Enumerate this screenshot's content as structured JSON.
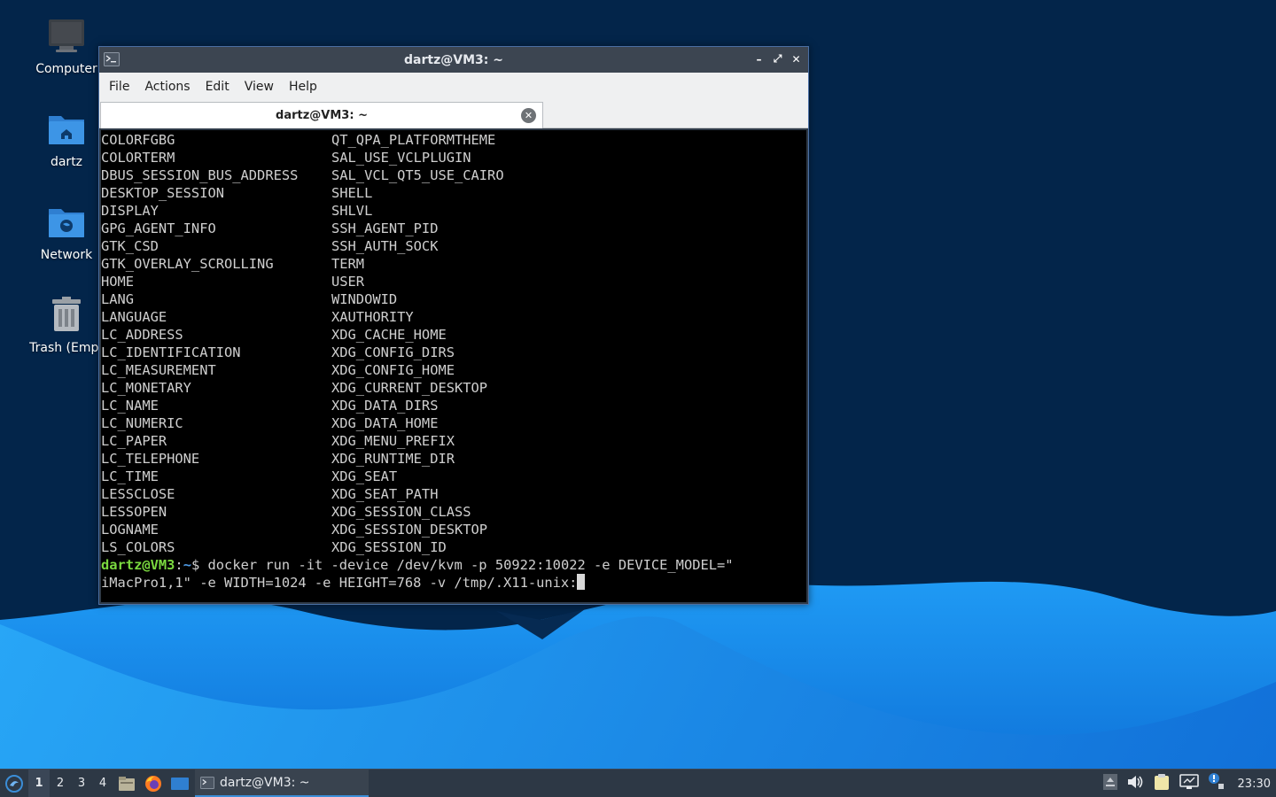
{
  "desktop": {
    "icons": [
      {
        "label": "Computer",
        "icon": "computer-icon"
      },
      {
        "label": "dartz",
        "icon": "home-folder-icon"
      },
      {
        "label": "Network",
        "icon": "network-folder-icon"
      },
      {
        "label": "Trash (Empt",
        "icon": "trash-icon"
      }
    ]
  },
  "window": {
    "title": "dartz@VM3: ~",
    "menu": [
      "File",
      "Actions",
      "Edit",
      "View",
      "Help"
    ],
    "tab_label": "dartz@VM3: ~",
    "tab_close_glyph": "✕",
    "controls": {
      "minimize": "–",
      "maximize": "⤢",
      "close": "✕"
    }
  },
  "terminal": {
    "env_rows": [
      [
        "COLORFGBG",
        "QT_QPA_PLATFORMTHEME"
      ],
      [
        "COLORTERM",
        "SAL_USE_VCLPLUGIN"
      ],
      [
        "DBUS_SESSION_BUS_ADDRESS",
        "SAL_VCL_QT5_USE_CAIRO"
      ],
      [
        "DESKTOP_SESSION",
        "SHELL"
      ],
      [
        "DISPLAY",
        "SHLVL"
      ],
      [
        "GPG_AGENT_INFO",
        "SSH_AGENT_PID"
      ],
      [
        "GTK_CSD",
        "SSH_AUTH_SOCK"
      ],
      [
        "GTK_OVERLAY_SCROLLING",
        "TERM"
      ],
      [
        "HOME",
        "USER"
      ],
      [
        "LANG",
        "WINDOWID"
      ],
      [
        "LANGUAGE",
        "XAUTHORITY"
      ],
      [
        "LC_ADDRESS",
        "XDG_CACHE_HOME"
      ],
      [
        "LC_IDENTIFICATION",
        "XDG_CONFIG_DIRS"
      ],
      [
        "LC_MEASUREMENT",
        "XDG_CONFIG_HOME"
      ],
      [
        "LC_MONETARY",
        "XDG_CURRENT_DESKTOP"
      ],
      [
        "LC_NAME",
        "XDG_DATA_DIRS"
      ],
      [
        "LC_NUMERIC",
        "XDG_DATA_HOME"
      ],
      [
        "LC_PAPER",
        "XDG_MENU_PREFIX"
      ],
      [
        "LC_TELEPHONE",
        "XDG_RUNTIME_DIR"
      ],
      [
        "LC_TIME",
        "XDG_SEAT"
      ],
      [
        "LESSCLOSE",
        "XDG_SEAT_PATH"
      ],
      [
        "LESSOPEN",
        "XDG_SESSION_CLASS"
      ],
      [
        "LOGNAME",
        "XDG_SESSION_DESKTOP"
      ],
      [
        "LS_COLORS",
        "XDG_SESSION_ID"
      ]
    ],
    "prompt": {
      "user_host": "dartz@VM3",
      "separator": ":",
      "path": "~",
      "symbol": "$",
      "command_line1": " docker run -it -device /dev/kvm -p 50922:10022 -e DEVICE_MODEL=\"",
      "command_line2": "iMacPro1,1\" -e WIDTH=1024 -e HEIGHT=768 -v /tmp/.X11-unix:"
    }
  },
  "taskbar": {
    "workspaces": [
      "1",
      "2",
      "3",
      "4"
    ],
    "active_workspace": "1",
    "task_label": "dartz@VM3: ~",
    "clock": "23:30",
    "tray_icons": [
      "upload-indicator-icon",
      "volume-icon",
      "clipboard-icon",
      "network-monitor-icon",
      "update-notifier-icon"
    ]
  },
  "colors": {
    "wallpaper_dark": "#03254a",
    "wallpaper_light": "#1e8ff0",
    "prompt_user": "#7ad83f",
    "prompt_path": "#4e9be6",
    "terminal_bg": "#000000",
    "accent": "#3b8ed8"
  }
}
